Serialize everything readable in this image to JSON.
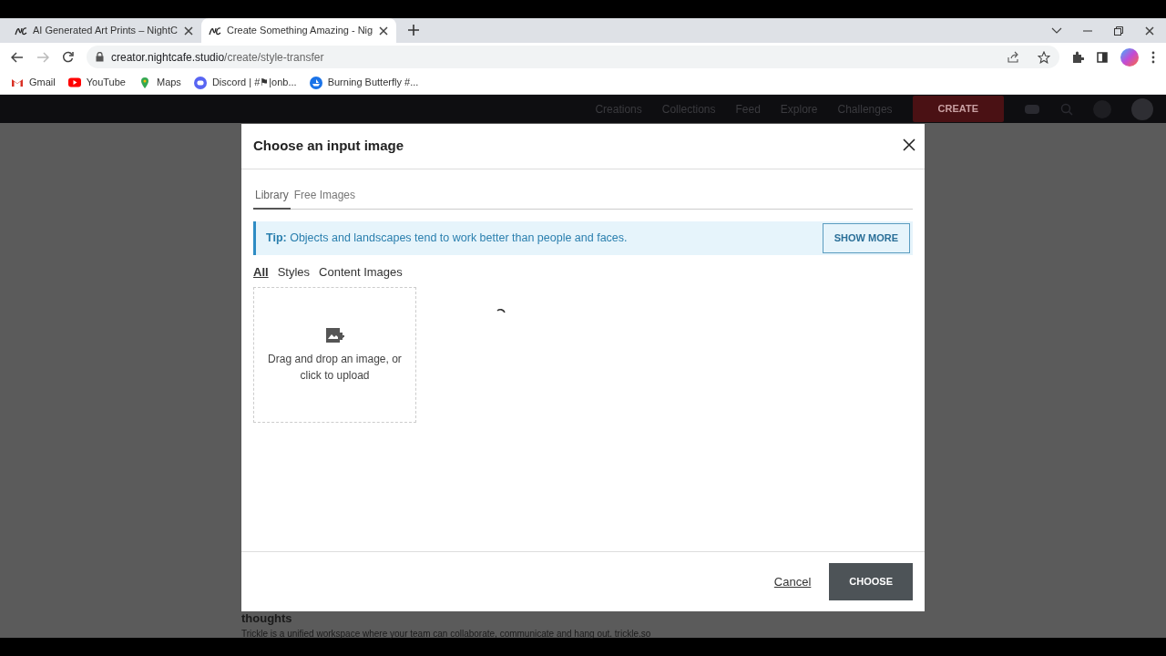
{
  "browser": {
    "tabs": [
      {
        "title": "AI Generated Art Prints – NightC",
        "selected": false
      },
      {
        "title": "Create Something Amazing - Nig",
        "selected": true
      }
    ],
    "url_host": "creator.nightcafe.studio",
    "url_path": "/create/style-transfer",
    "bookmarks": [
      {
        "kind": "gmail",
        "label": "Gmail"
      },
      {
        "kind": "youtube",
        "label": "YouTube"
      },
      {
        "kind": "maps",
        "label": "Maps"
      },
      {
        "kind": "discord",
        "label": "Discord | #⚑|onb..."
      },
      {
        "kind": "boat",
        "label": "Burning Butterfly #..."
      }
    ]
  },
  "page": {
    "nav": [
      "Creations",
      "Collections",
      "Feed",
      "Explore",
      "Challenges"
    ],
    "create_button": "CREATE",
    "ad": {
      "headline": "thoughts",
      "text": "Trickle is a unified workspace where your team can collaborate, communicate and hang out. trickle.so"
    }
  },
  "dialog": {
    "title": "Choose an input image",
    "tabs": [
      {
        "label": "Library",
        "selected": true
      },
      {
        "label": "Free Images",
        "selected": false
      }
    ],
    "tip": {
      "text": "**Tip:** Objects and landscapes tend to work better than people and faces.",
      "button": "SHOW MORE"
    },
    "filters": [
      {
        "label": "All",
        "selected": true
      },
      {
        "label": "Styles",
        "selected": false
      },
      {
        "label": "Content Images",
        "selected": false
      }
    ],
    "upload": {
      "text": "Drag and drop an image, or click to upload"
    },
    "loading": true,
    "cancel": "Cancel",
    "choose": "CHOOSE"
  }
}
